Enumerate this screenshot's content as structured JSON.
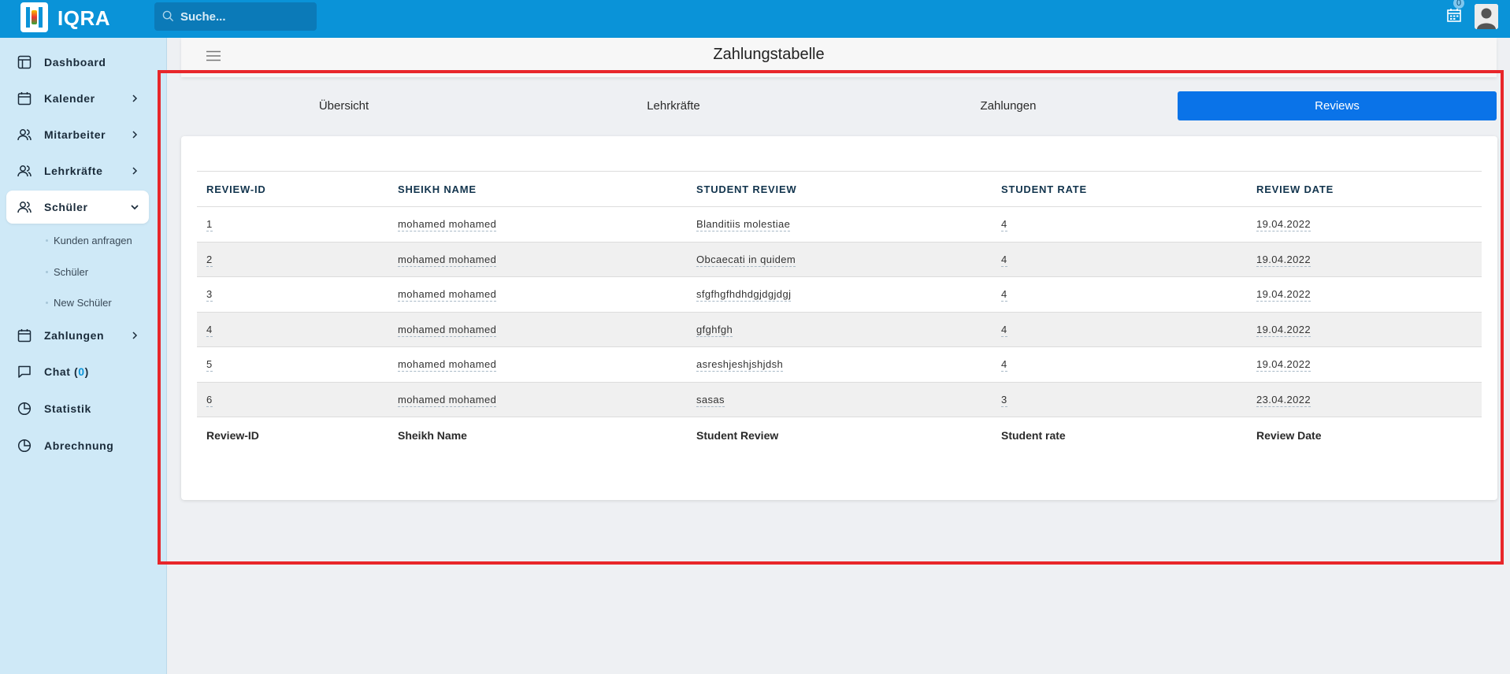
{
  "app": {
    "title": "IQRA"
  },
  "search": {
    "placeholder": "Suche..."
  },
  "topbar": {
    "calendar_badge": "0"
  },
  "sidebar": {
    "items": [
      {
        "label": "Dashboard"
      },
      {
        "label": "Kalender"
      },
      {
        "label": "Mitarbeiter"
      },
      {
        "label": "Lehrkräfte"
      },
      {
        "label": "Schüler"
      },
      {
        "label": "Zahlungen"
      },
      {
        "label": "Chat (",
        "count": "0",
        "suffix": ")"
      },
      {
        "label": "Statistik"
      },
      {
        "label": "Abrechnung"
      }
    ],
    "sub_items": [
      {
        "label": "Kunden anfragen"
      },
      {
        "label": "Schüler"
      },
      {
        "label": "New Schüler"
      }
    ]
  },
  "header": {
    "title": "Zahlungstabelle"
  },
  "tabs": [
    {
      "label": "Übersicht",
      "active": false
    },
    {
      "label": "Lehrkräfte",
      "active": false
    },
    {
      "label": "Zahlungen",
      "active": false
    },
    {
      "label": "Reviews",
      "active": true
    }
  ],
  "table": {
    "headers": [
      "REVIEW-ID",
      "SHEIKH NAME",
      "STUDENT REVIEW",
      "STUDENT RATE",
      "REVIEW DATE"
    ],
    "rows": [
      [
        "1",
        "mohamed mohamed",
        "Blanditiis molestiae",
        "4",
        "19.04.2022"
      ],
      [
        "2",
        "mohamed mohamed",
        "Obcaecati in quidem",
        "4",
        "19.04.2022"
      ],
      [
        "3",
        "mohamed mohamed",
        "sfgfhgfhdhdgjdgjdgj",
        "4",
        "19.04.2022"
      ],
      [
        "4",
        "mohamed mohamed",
        "gfghfgh",
        "4",
        "19.04.2022"
      ],
      [
        "5",
        "mohamed mohamed",
        "asreshjeshjshjdsh",
        "4",
        "19.04.2022"
      ],
      [
        "6",
        "mohamed mohamed",
        "sasas",
        "3",
        "23.04.2022"
      ]
    ],
    "footers": [
      "Review-ID",
      "Sheikh Name",
      "Student Review",
      "Student rate",
      "Review Date"
    ]
  },
  "colors": {
    "topbar": "#0a93d8",
    "sidebar": "#cfe9f7",
    "active_tab": "#0a73e8",
    "frame": "#e8262a"
  }
}
